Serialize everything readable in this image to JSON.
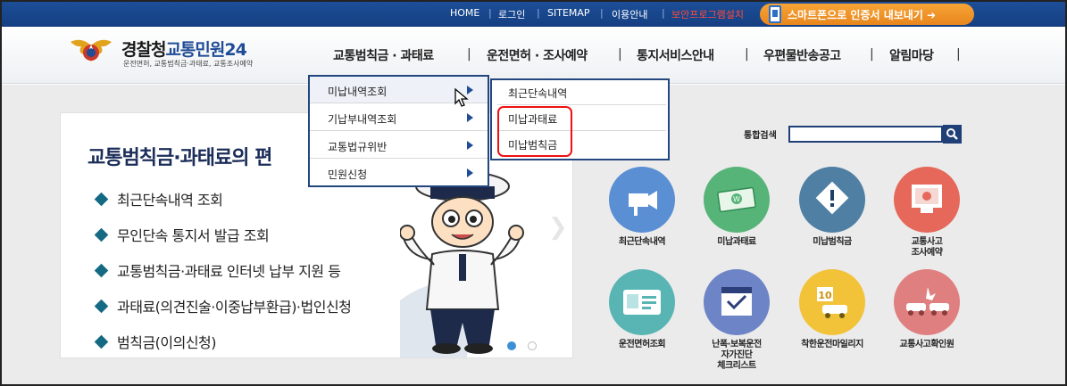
{
  "topbar": {
    "links": [
      "HOME",
      "로그인",
      "SITEMAP",
      "이용안내",
      "보안프로그램설치"
    ],
    "smartphone_label": "스마트폰으로 인증서 내보내기 ➜"
  },
  "header": {
    "logo_main": "경찰청",
    "logo_blue": "교통민원24",
    "logo_sub": "운전면허, 교통범칙금·과태료, 교통조사예약",
    "nav": [
      "교통범칙금 · 과태료",
      "운전면허 · 조사예약",
      "통지서비스안내",
      "우편물반송공고",
      "알림마당"
    ]
  },
  "menu_level1": {
    "items": [
      "미납내역조회",
      "기납부내역조회",
      "교통법규위반",
      "민원신청"
    ],
    "active_index": 0
  },
  "menu_level2": {
    "items": [
      "최근단속내역",
      "미납과태료",
      "미납범칙금"
    ]
  },
  "banner": {
    "title": "교통범칙금·과태료의 편",
    "bullets": [
      "최근단속내역 조회",
      "무인단속 통지서 발급 조회",
      "교통범칙금·과태료 인터넷 납부 지원 등",
      "과태료(의견진술·이중납부환급)·법인신청",
      "범칙금(이의신청)"
    ],
    "active_dot": 0
  },
  "search": {
    "label": "통합검색",
    "value": ""
  },
  "services": [
    {
      "label": "최근단속내역",
      "icon": "cctv-camera-icon",
      "color": "#5b8fd3"
    },
    {
      "label": "미납과태료",
      "icon": "money-bills-icon",
      "color": "#57b478"
    },
    {
      "label": "미납범칙금",
      "icon": "warning-diamond-icon",
      "color": "#4f7fa3"
    },
    {
      "label": "교통사고\n조사예약",
      "icon": "monitor-icon",
      "color": "#e5685a"
    },
    {
      "label": "운전면허조회",
      "icon": "id-card-icon",
      "color": "#58b5b3"
    },
    {
      "label": "난폭·보복운전\n자가진단\n체크리스트",
      "icon": "calendar-check-icon",
      "color": "#6d84c6"
    },
    {
      "label": "착한운전마일리지",
      "icon": "mileage-car-icon",
      "color": "#f2c239"
    },
    {
      "label": "교통사고확인원",
      "icon": "car-crash-icon",
      "color": "#e07f80"
    }
  ]
}
